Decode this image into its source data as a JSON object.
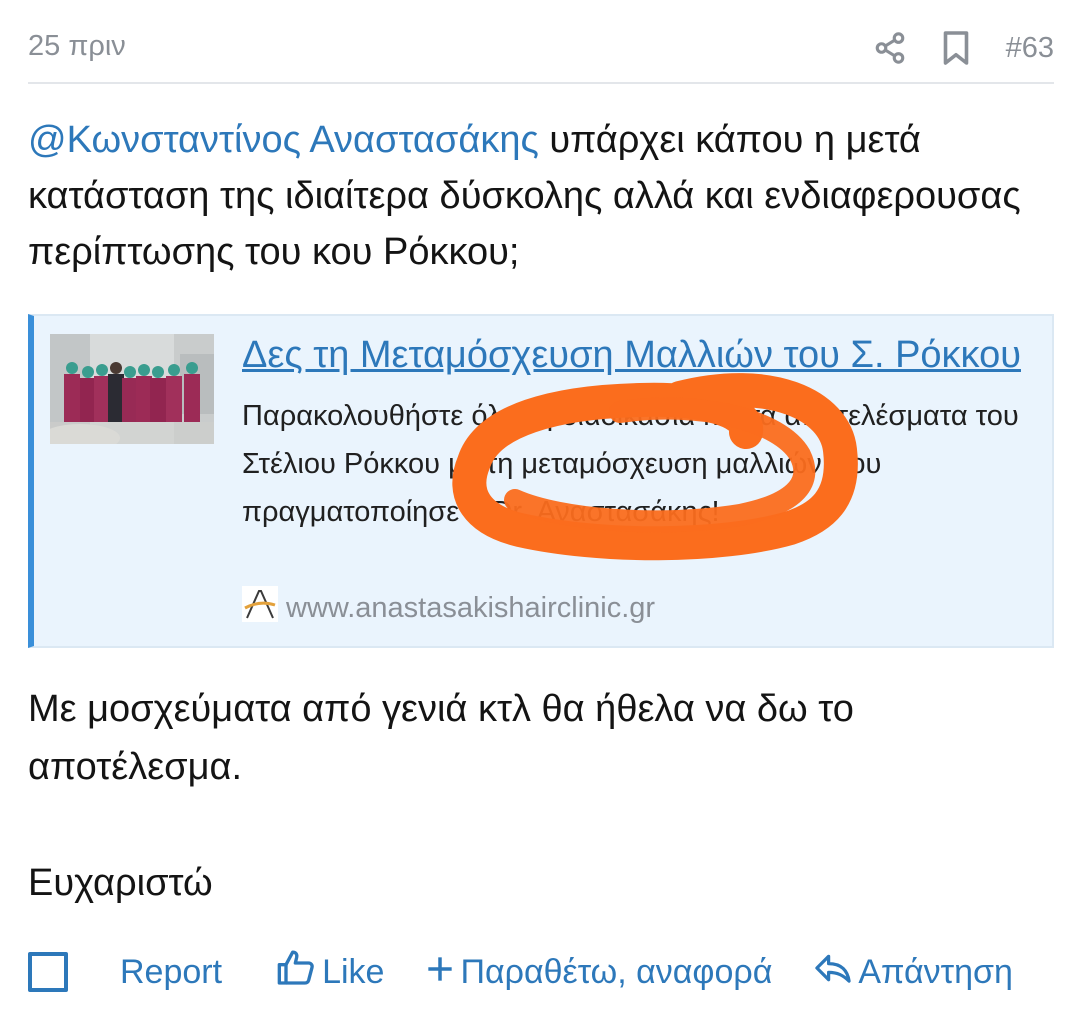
{
  "header": {
    "time": "25 πριν",
    "post_number": "#63"
  },
  "icons": {
    "share": "share-icon",
    "bookmark": "bookmark-icon",
    "like": "thumbs-up-icon",
    "quote": "plus-icon",
    "reply": "reply-icon"
  },
  "colors": {
    "link": "#2d78ba",
    "card_background": "#eaf4fd",
    "card_accent": "#3a8fd9",
    "muted": "#8a8f96",
    "scribble": "#fb6d1d"
  },
  "post": {
    "mention": "@Κωνσταντίνος Αναστασάκης",
    "text": " υπάρχει κάπου η μετά κατάσταση της ιδιαίτερα δύσκολης αλλά και ενδιαφερουσας περίπτωσης του κου Ρόκκου;",
    "paragraph2": "Με μοσχεύματα από γενιά κτλ θα ήθελα να δω το αποτέλεσμα.",
    "paragraph3": "Ευχαριστώ"
  },
  "link_card": {
    "title": "Δες τη Μεταμόσχευση Μαλλιών του Σ. Ρόκκου",
    "description": "Παρακολουθήστε όλη τη διαδικασία και τα αποτελέσματα του Στέλιου Ρόκκου με τη μεταμόσχευση μαλλιών που πραγματοποίησε ο Dr. Αναστασάκης!",
    "domain": "www.anastasakishairclinic.gr"
  },
  "footer": {
    "report": "Report",
    "like": "Like",
    "quote": "Παραθέτω, αναφορά",
    "reply": "Απάντηση"
  }
}
